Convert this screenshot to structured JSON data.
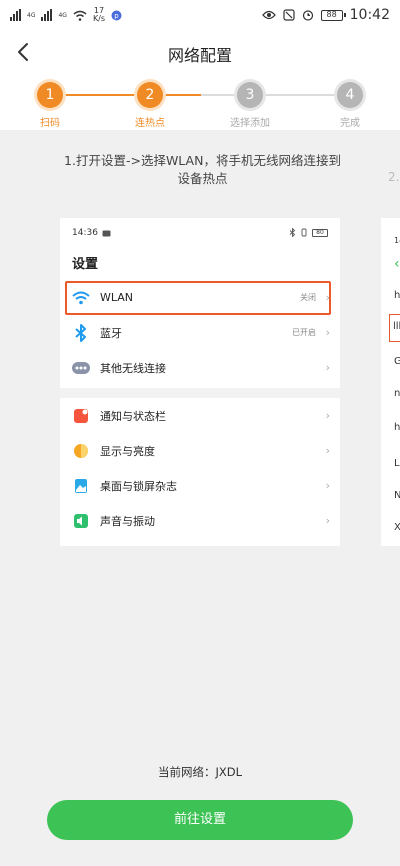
{
  "status_bar": {
    "netspeed_value": "17",
    "netspeed_unit": "K/s",
    "signal1_label": "4G",
    "signal2_label": "4G",
    "time": "10:42",
    "battery": "88"
  },
  "header": {
    "title": "网络配置"
  },
  "steps": [
    {
      "number": "1",
      "label": "扫码",
      "state": "done"
    },
    {
      "number": "2",
      "label": "连热点",
      "state": "current"
    },
    {
      "number": "3",
      "label": "选择添加",
      "state": "pending"
    },
    {
      "number": "4",
      "label": "完成",
      "state": "pending"
    }
  ],
  "instruction": "1.打开设置->选择WLAN，将手机无线网络连接到设备热点",
  "peek_instruction": "2.",
  "settings_preview": {
    "time": "14:36",
    "battery": "80",
    "title": "设置",
    "group1": [
      {
        "label": "WLAN",
        "value": "关闭",
        "icon": "wifi-icon"
      },
      {
        "label": "蓝牙",
        "value": "已开启",
        "icon": "bluetooth-icon"
      },
      {
        "label": "其他无线连接",
        "value": "",
        "icon": "more-icon"
      }
    ],
    "group2": [
      {
        "label": "通知与状态栏",
        "icon": "notification-icon"
      },
      {
        "label": "显示与亮度",
        "icon": "display-icon"
      },
      {
        "label": "桌面与锁屏杂志",
        "icon": "wallpaper-icon"
      },
      {
        "label": "声音与振动",
        "icon": "sound-icon"
      }
    ]
  },
  "peek_card": {
    "lines": [
      "14",
      "h",
      "lll",
      "G",
      "n",
      "h",
      "L",
      "N",
      "X"
    ]
  },
  "current_network": "当前网络：JXDL",
  "primary_button": "前往设置",
  "colors": {
    "accent": "#f08a24",
    "button": "#3dc256",
    "highlight": "#ea5a2a"
  }
}
